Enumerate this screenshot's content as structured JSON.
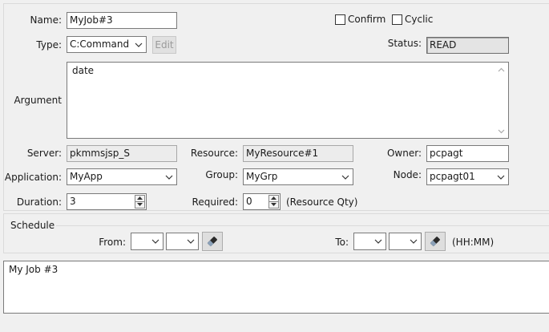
{
  "job": {
    "name_label": "Name:",
    "name_value": "MyJob#3",
    "type_label": "Type:",
    "type_value": "C:Command",
    "edit_label": "Edit",
    "confirm_label": "Confirm",
    "confirm_checked": false,
    "cyclic_label": "Cyclic",
    "cyclic_checked": false,
    "status_label": "Status:",
    "status_value": "READ",
    "argument_label": "Argument",
    "argument_value": "date"
  },
  "details": {
    "server_label": "Server:",
    "server_value": "pkmmsjsp_S",
    "resource_label": "Resource:",
    "resource_value": "MyResource#1",
    "owner_label": "Owner:",
    "owner_value": "pcpagt",
    "application_label": "Application:",
    "application_value": "MyApp",
    "group_label": "Group:",
    "group_value": "MyGrp",
    "node_label": "Node:",
    "node_value": "pcpagt01",
    "duration_label": "Duration:",
    "duration_value": "3",
    "required_label": "Required:",
    "required_value": "0",
    "resource_qty_label": "(Resource Qty)"
  },
  "schedule": {
    "title": "Schedule",
    "from_label": "From:",
    "to_label": "To:",
    "time_format_label": "(HH:MM)",
    "from_hour": "",
    "from_minute": "",
    "to_hour": "",
    "to_minute": ""
  },
  "description": {
    "value": "My Job #3"
  },
  "icons": {
    "dropdown": "chevron-down-icon",
    "clear": "eraser-icon",
    "spin_up": "spin-up-icon",
    "spin_down": "spin-down-icon"
  }
}
